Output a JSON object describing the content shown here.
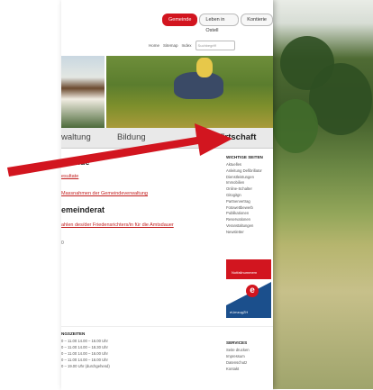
{
  "topnav": {
    "items": [
      "Gemeinde",
      "Leben in Ostell",
      "Kontierie"
    ]
  },
  "utility": {
    "links": [
      "Home",
      "Sitemap",
      "Index"
    ],
    "search_placeholder": "Suchbegriff"
  },
  "menu": {
    "items": [
      "waltung",
      "Bildung",
      "Wirtschaft"
    ]
  },
  "content": {
    "heading1": "meinde",
    "link1": "esultate",
    "link2": "Massnahmen der Gemeindeverwaltung",
    "heading2": "emeinderat",
    "link3": "ahlen des/der Friedensrichters/in für die Amtsdauer",
    "number": "0"
  },
  "sidebar": {
    "title": "WICHTIGE SEITEN",
    "items": [
      "Aktuelles",
      "Anleitung Defibrillator",
      "Dienstleistungen",
      "Immobilien",
      "Online-Schalter",
      "Gitogitgn",
      "Partnervertrag",
      "Fotowettbewerb",
      "Publikationen",
      "Reservationen",
      "Veranstaltungen",
      "Newsletter"
    ]
  },
  "banners": {
    "notfall": "Notfallnummern",
    "ezug": "eUmzugZH"
  },
  "footer": {
    "hours_title": "NGSZEITEN",
    "hours": [
      "0 – 11.00    14.00 – 16.00 Uhr",
      "0 – 11.00    14.00 – 18.30 Uhr",
      "0 – 11.00    14.00 – 16.00 Uhr",
      "0 – 11.00    14.00 – 16.00 Uhr",
      "0 – 19.00 Uhr (durchgehend)"
    ],
    "services_title": "SERVICES",
    "services": [
      "Seite drucken",
      "Impressum",
      "Datenschutz",
      "Kontakt"
    ]
  },
  "colors": {
    "accent": "#d2151f",
    "arrow": "#d2151f"
  }
}
